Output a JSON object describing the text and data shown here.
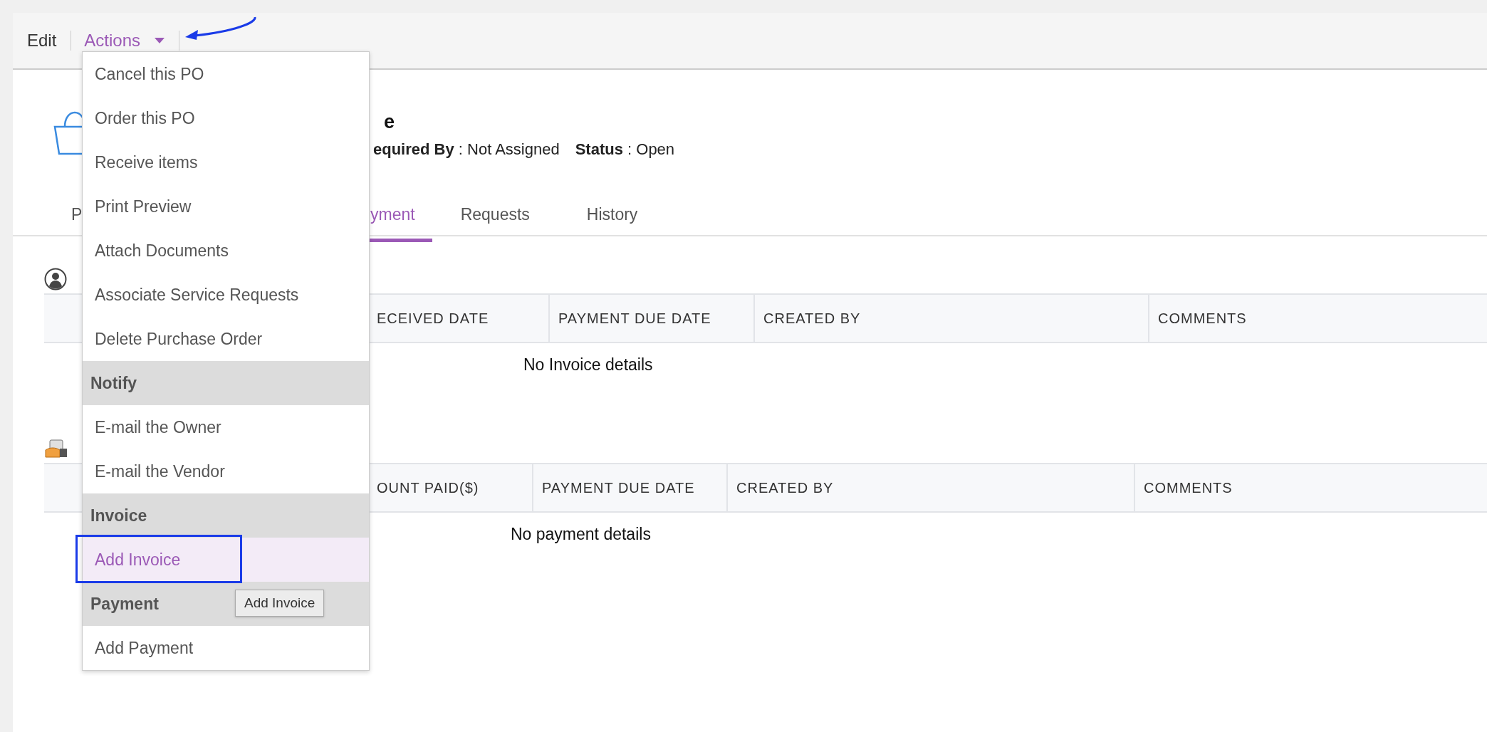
{
  "toolbar": {
    "edit": "Edit",
    "actions": "Actions",
    "actions_expanded": true
  },
  "menu": [
    {
      "kind": "item",
      "label": "Cancel this PO",
      "selected": false
    },
    {
      "kind": "item",
      "label": "Order this PO",
      "selected": false
    },
    {
      "kind": "item",
      "label": "Receive items",
      "selected": false
    },
    {
      "kind": "item",
      "label": "Print Preview",
      "selected": false
    },
    {
      "kind": "item",
      "label": "Attach Documents",
      "selected": false
    },
    {
      "kind": "item",
      "label": "Associate Service Requests",
      "selected": false
    },
    {
      "kind": "item",
      "label": "Delete Purchase Order",
      "selected": false
    },
    {
      "kind": "header",
      "label": "Notify"
    },
    {
      "kind": "item",
      "label": "E-mail the Owner",
      "selected": false
    },
    {
      "kind": "item",
      "label": "E-mail the Vendor",
      "selected": false
    },
    {
      "kind": "header",
      "label": "Invoice"
    },
    {
      "kind": "item",
      "label": "Add Invoice",
      "selected": true
    },
    {
      "kind": "header",
      "label": "Payment"
    },
    {
      "kind": "item",
      "label": "Add Payment",
      "selected": false
    }
  ],
  "tooltip": "Add Invoice",
  "header": {
    "title": "e",
    "required_by": "**equired By** : Not Assigned",
    "status": "**Status** : Open"
  },
  "tabs": [
    {
      "label": "P",
      "selected": false
    },
    {
      "label": "yment",
      "selected": true
    },
    {
      "label": "Requests",
      "selected": false
    },
    {
      "label": "History",
      "selected": false
    }
  ],
  "invoices": {
    "columns": [
      "ECEIVED DATE",
      "PAYMENT DUE DATE",
      "CREATED BY",
      "COMMENTS"
    ],
    "empty": "No Invoice details"
  },
  "payments": {
    "columns": [
      "OUNT PAID($)",
      "PAYMENT DUE DATE",
      "CREATED BY",
      "COMMENTS"
    ],
    "empty": "No payment details"
  }
}
